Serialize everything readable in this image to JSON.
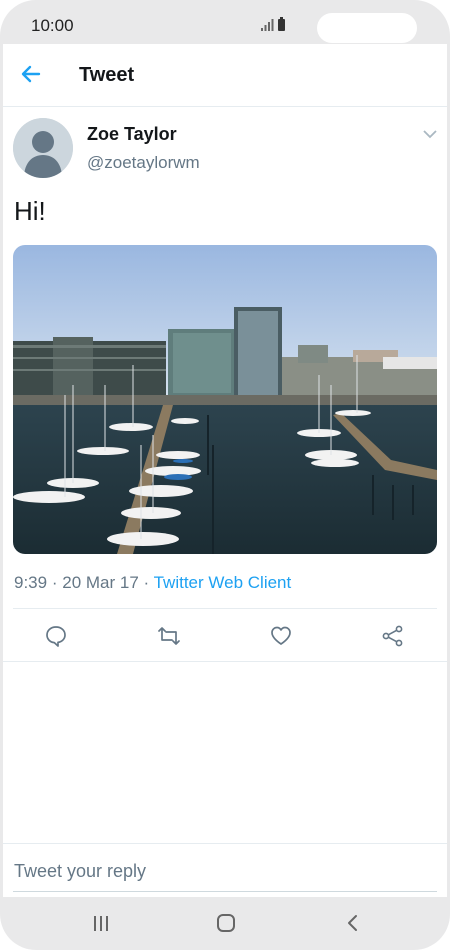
{
  "status_bar": {
    "time": "10:00"
  },
  "header": {
    "title": "Tweet"
  },
  "tweet": {
    "author_name": "Zoe Taylor",
    "author_handle": "@zoetaylorwm",
    "text": "Hi!",
    "time": "9:39",
    "separator": "·",
    "date": "20 Mar 17",
    "source": "Twitter Web Client"
  },
  "actions": [
    "reply-icon",
    "retweet-icon",
    "like-icon",
    "share-icon"
  ],
  "reply": {
    "placeholder": "Tweet your reply"
  },
  "colors": {
    "accent": "#1da1f2",
    "text": "#14171a",
    "secondary": "#657786"
  }
}
